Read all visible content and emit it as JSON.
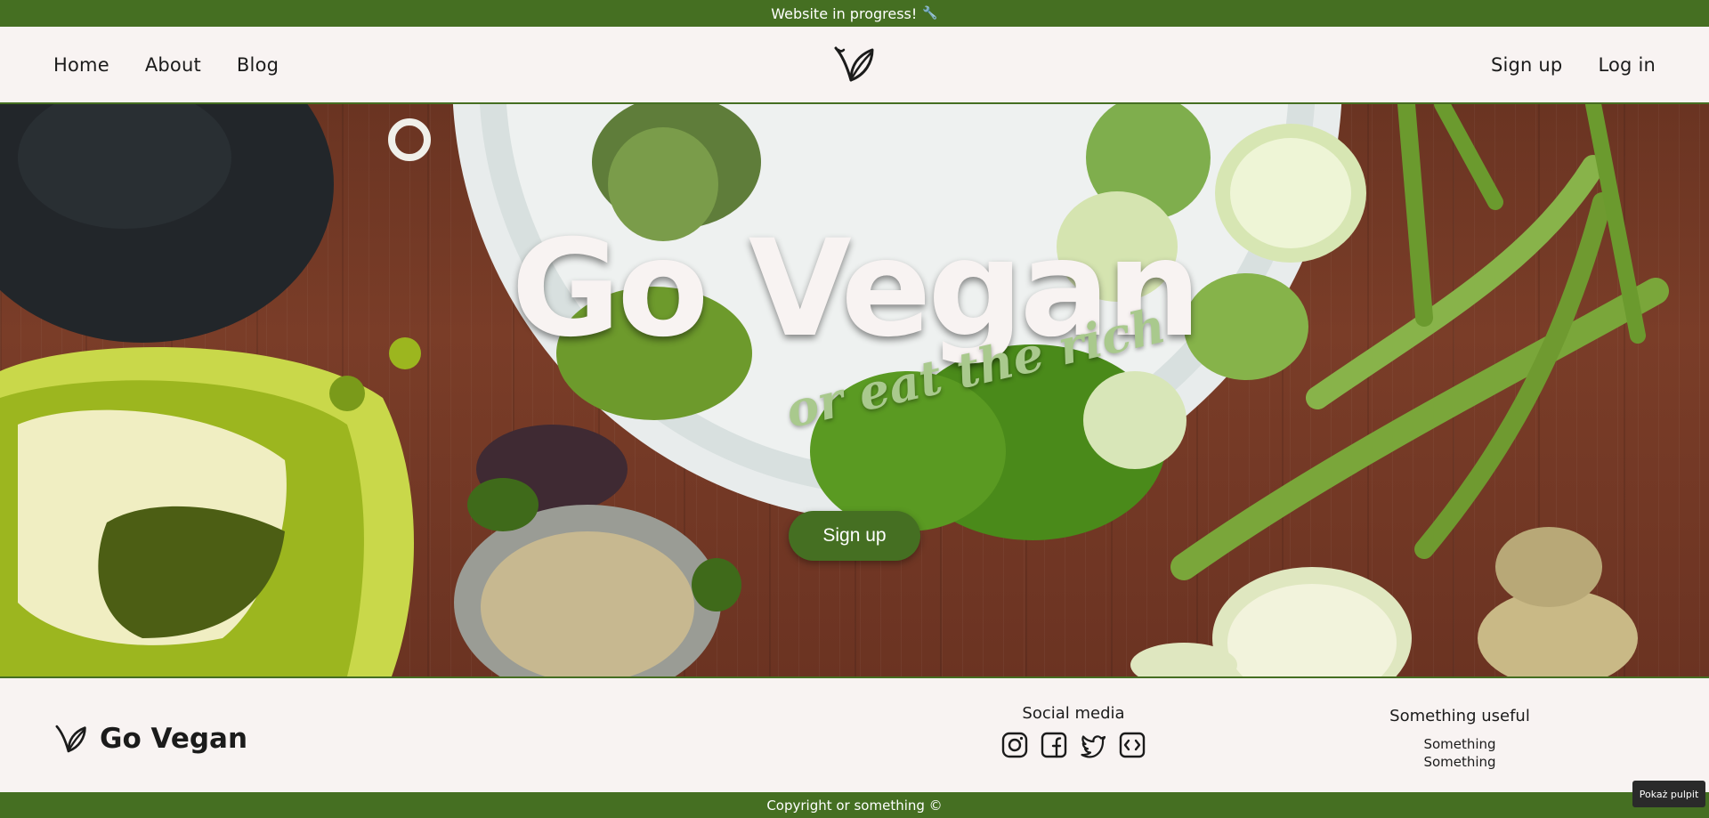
{
  "banner": {
    "text": "Website in progress!",
    "icon": "wrench-icon"
  },
  "nav": {
    "left": [
      {
        "label": "Home"
      },
      {
        "label": "About"
      },
      {
        "label": "Blog"
      }
    ],
    "right": [
      {
        "label": "Sign up"
      },
      {
        "label": "Log in"
      }
    ],
    "logo": "leaf-logo-icon"
  },
  "hero": {
    "title": "Go Vegan",
    "subtitle": "or eat the rich",
    "cta_label": "Sign up"
  },
  "footer": {
    "brand_name": "Go Vegan",
    "social_title": "Social media",
    "social_icons": [
      "instagram-icon",
      "facebook-icon",
      "twitter-icon",
      "code-icon"
    ],
    "useful_title": "Something useful",
    "useful_links": [
      "Something",
      "Something"
    ],
    "copyright": "Copyright or something ©"
  },
  "desktop_button": "Pokaż pulpit",
  "colors": {
    "accent": "#456f22",
    "background": "#f8f3f2",
    "subtitle": "#a9c98d"
  }
}
